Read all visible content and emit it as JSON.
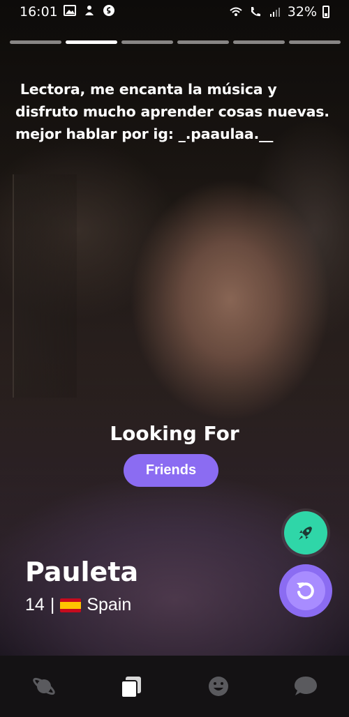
{
  "status": {
    "time": "16:01",
    "battery": "32%"
  },
  "stories": {
    "count": 6,
    "active_index": 1
  },
  "profile": {
    "bio_lines": [
      " Lectora, me encanta la música y",
      "disfruto mucho aprender cosas nuevas.",
      "mejor hablar por ig: _.paaulaa.__"
    ],
    "looking_for_title": "Looking For",
    "looking_for_value": "Friends",
    "name": "Pauleta",
    "age": "14",
    "separator": "|",
    "country": "Spain",
    "flag": "spain-flag-icon"
  },
  "actions": {
    "boost_icon": "rocket-icon",
    "undo_icon": "undo-icon"
  },
  "nav": {
    "items": [
      "planet-icon",
      "cards-icon",
      "smiley-icon",
      "chat-icon"
    ],
    "active": "cards-icon"
  },
  "colors": {
    "accent_purple": "#8b6cf2",
    "boost_green": "#2fd6a8"
  }
}
